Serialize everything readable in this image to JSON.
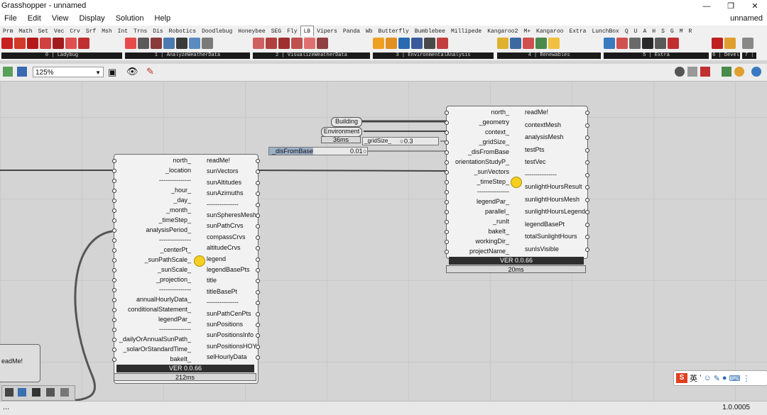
{
  "window": {
    "title": "Grasshopper - unnamed",
    "project": "unnamed"
  },
  "menu": [
    "File",
    "Edit",
    "View",
    "Display",
    "Solution",
    "Help"
  ],
  "tabs": [
    "Prm",
    "Math",
    "Set",
    "Vec",
    "Crv",
    "Srf",
    "Msh",
    "Int",
    "Trns",
    "Dis",
    "Robotics",
    "Doodlebug",
    "Honeybee",
    "SEG",
    "Fly",
    "LB",
    "Vipers",
    "Panda",
    "Wb",
    "Butterfly",
    "Bumblebee",
    "Millipede",
    "Kangaroo2",
    "M+",
    "Kangaroo",
    "Extra",
    "LunchBox",
    "Q",
    "U",
    "A",
    "H",
    "S",
    "G",
    "M",
    "R"
  ],
  "active_tab": "LB",
  "ribbon_groups": [
    "0 | Ladybug",
    "1 | AnalyzeWeatherData",
    "2 | VisualizeWeatherData",
    "3 | EnvironmentalAnalysis",
    "4 | Renewables",
    "5 | Extra",
    "6 | Devel",
    "7 |"
  ],
  "zoom": "125%",
  "sunpath": {
    "inputs": [
      "north_",
      "_location",
      "---------------",
      "_hour_",
      "_day_",
      "_month_",
      "_timeStep_",
      "analysisPeriod_",
      "---------------",
      "_centerPt_",
      "_sunPathScale_",
      "_sunScale_",
      "_projection_",
      "---------------",
      "annualHourlyData_",
      "conditionalStatement_",
      "legendPar_",
      "---------------",
      "_dailyOrAnnualSunPath_",
      "_solarOrStandardTime_",
      "bakeIt_"
    ],
    "outputs": [
      "readMe!",
      "sunVectors",
      "sunAltitudes",
      "sunAzimuths",
      "---------------",
      "sunSpheresMesh",
      "sunPathCrvs",
      "compassCrvs",
      "altitudeCrvs",
      "legend",
      "legendBasePts",
      "title",
      "titleBasePt",
      "---------------",
      "sunPathCenPts",
      "sunPositions",
      "sunPositionsInfo",
      "sunPositionsHOY",
      "selHourlyData"
    ],
    "version": "VER 0.0.66",
    "time": "212ms"
  },
  "sunlight": {
    "inputs": [
      "north_",
      "_geometry",
      "context_",
      "_gridSize_",
      "_disFromBase",
      "orientationStudyP_",
      "_sunVectors",
      "_timeStep_",
      "---------------",
      "legendPar_",
      "parallel_",
      "_runIt",
      "bakeIt_",
      "workingDir_",
      "projectName_"
    ],
    "outputs": [
      "readMe!",
      "contextMesh",
      "analysisMesh",
      "testPts",
      "testVec",
      "---------------",
      "sunlightHoursResult",
      "sunlightHoursMesh",
      "sunlightHoursLegend",
      "legendBasePt",
      "totalSunlightHours",
      "sunIsVisible"
    ],
    "version": "VER 0.0.66",
    "time": "20ms"
  },
  "params": {
    "building": "Building",
    "environment": "Environment",
    "env_time": "36ms"
  },
  "sliders": {
    "grid": {
      "label": "_gridSize_",
      "value": "0.3"
    },
    "dis": {
      "label": "_disFromBase",
      "value": "0.01"
    }
  },
  "readme_panel": "eadMe!",
  "status": {
    "version": "1.0.0005"
  },
  "ime": {
    "lang": "英"
  }
}
